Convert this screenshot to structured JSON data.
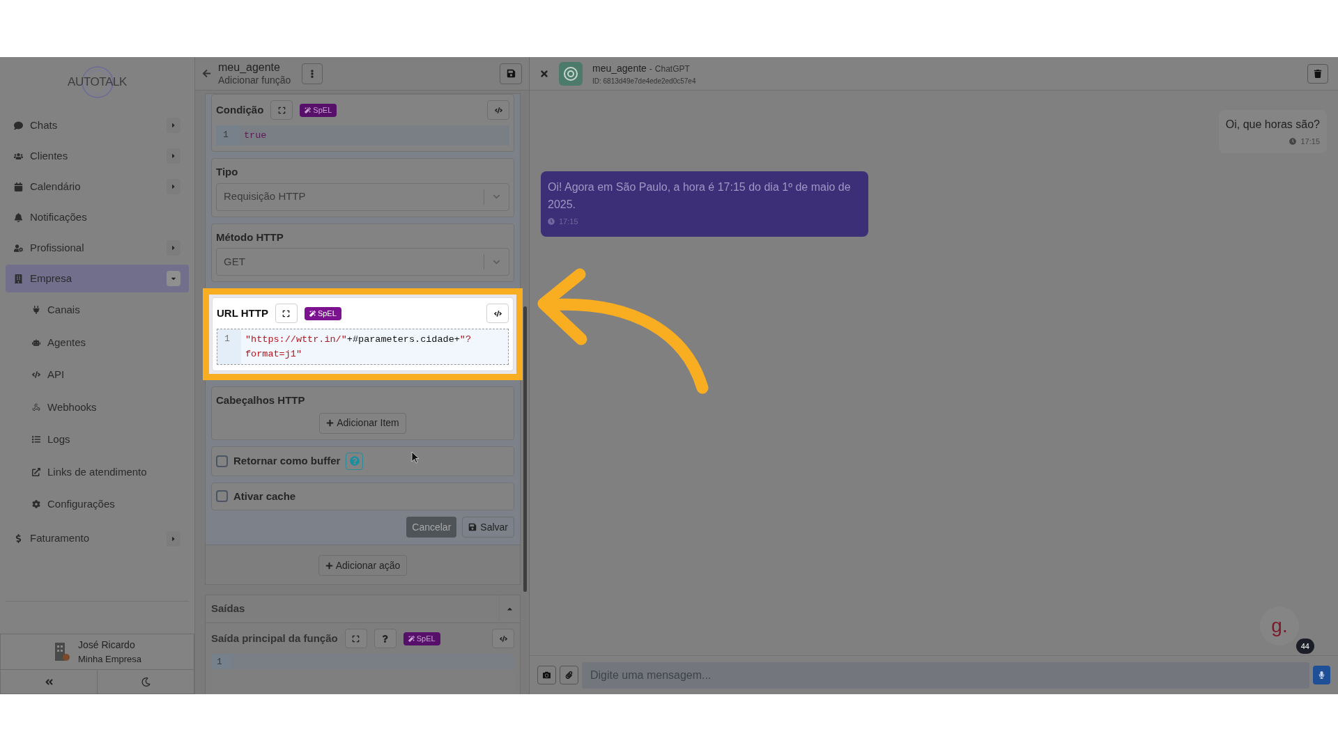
{
  "sidebar": {
    "logo": "AUTOTALK",
    "items": [
      {
        "label": "Chats",
        "kind": "group",
        "expanded": false,
        "selected": false
      },
      {
        "label": "Clientes",
        "kind": "group",
        "expanded": false,
        "selected": false
      },
      {
        "label": "Calendário",
        "kind": "group",
        "expanded": false,
        "selected": false
      },
      {
        "label": "Notificações",
        "kind": "link",
        "selected": false
      },
      {
        "label": "Profissional",
        "kind": "group",
        "expanded": false,
        "selected": false
      },
      {
        "label": "Empresa",
        "kind": "group",
        "expanded": true,
        "selected": true,
        "children": [
          {
            "label": "Canais"
          },
          {
            "label": "Agentes"
          },
          {
            "label": "API"
          },
          {
            "label": "Webhooks"
          },
          {
            "label": "Logs"
          },
          {
            "label": "Links de atendimento"
          },
          {
            "label": "Configurações"
          }
        ]
      },
      {
        "label": "Faturamento",
        "kind": "group",
        "expanded": false,
        "selected": false
      }
    ],
    "user": {
      "name": "José Ricardo",
      "company": "Minha Empresa"
    }
  },
  "editor": {
    "title": "meu_agente",
    "subtitle": "Adicionar função",
    "fields": [
      {
        "kind": "code",
        "label": "Condição",
        "badge": "SpEL",
        "highlighted": false,
        "line_number": "1",
        "tokens": [
          {
            "text": "true",
            "kind": "keyword"
          }
        ]
      },
      {
        "kind": "select",
        "label": "Tipo",
        "value": "Requisição HTTP",
        "highlighted": false
      },
      {
        "kind": "select",
        "label": "Método HTTP",
        "value": "GET",
        "highlighted": false
      },
      {
        "kind": "code",
        "label": "URL HTTP",
        "badge": "SpEL",
        "highlighted": true,
        "line_number": "1",
        "tokens": [
          {
            "text": "\"https://wttr.in/\"",
            "kind": "string"
          },
          {
            "text": "+#parameters.cidade+",
            "kind": "plain"
          },
          {
            "text": "\"?format=j1\"",
            "kind": "string"
          }
        ]
      },
      {
        "kind": "list",
        "label": "Cabeçalhos HTTP",
        "button": "Adicionar Item",
        "highlighted": false
      },
      {
        "kind": "checkbox",
        "label": "Retornar como buffer",
        "checked": false,
        "help": true,
        "highlighted": false
      },
      {
        "kind": "checkbox",
        "label": "Ativar cache",
        "checked": false,
        "help": false,
        "highlighted": false
      }
    ],
    "cancel": "Cancelar",
    "save": "Salvar",
    "add_action": "Adicionar ação",
    "outputs": {
      "title": "Saídas",
      "expanded": true,
      "field_label": "Saída principal da função",
      "badge": "SpEL",
      "line_number": "1"
    }
  },
  "chat": {
    "agent": "meu_agente",
    "provider": "ChatGPT",
    "id": "ID: 6813d49e7de4ede2ed0c57e4",
    "separator": "-",
    "messages": [
      {
        "kind": "sent",
        "text": "Oi, que horas são?",
        "time": "17:15"
      },
      {
        "kind": "received",
        "text": "Oi! Agora em São Paulo, a hora é 17:15 do dia 1º de maio de 2025.",
        "time": "17:15"
      }
    ],
    "input_placeholder": "Digite uma mensagem...",
    "widget_logo": "g.",
    "widget_badge": "44"
  }
}
